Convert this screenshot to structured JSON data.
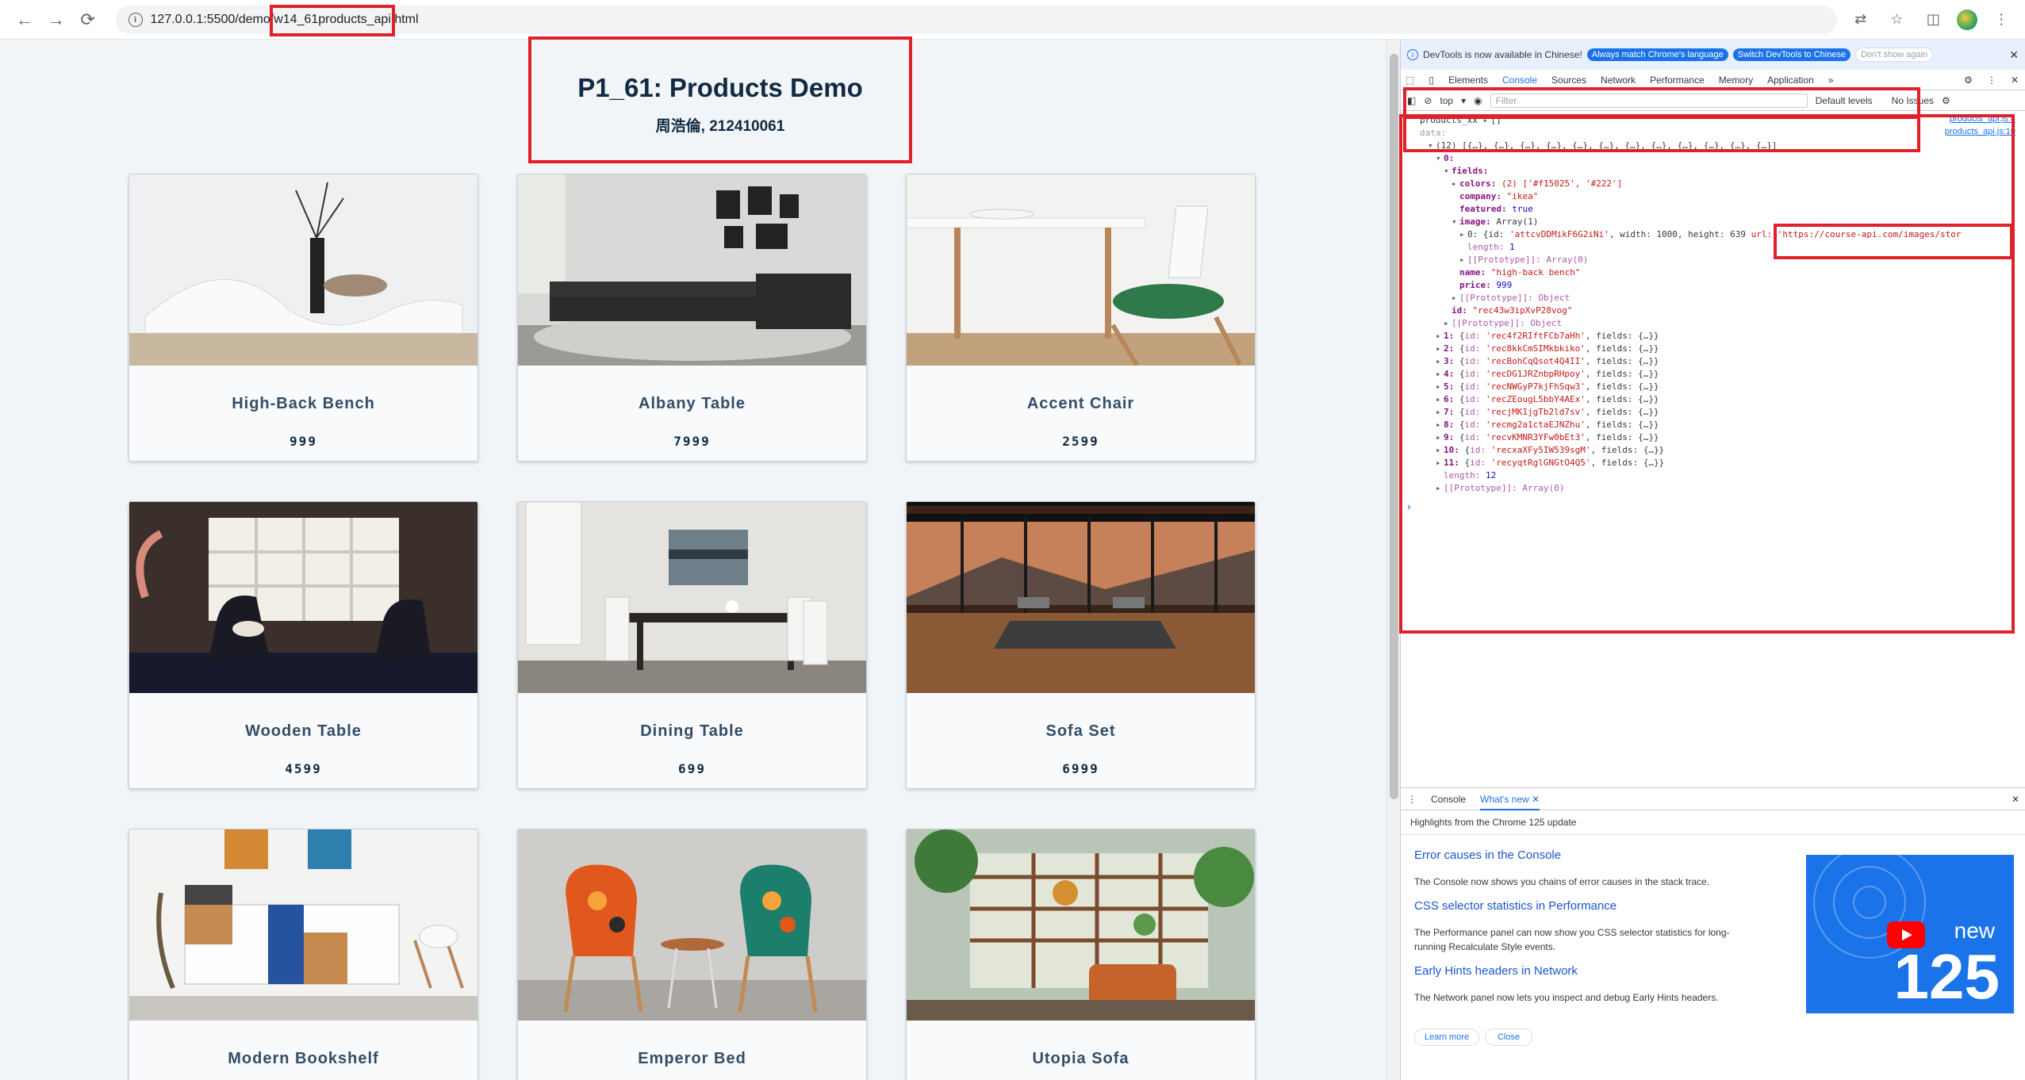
{
  "browser": {
    "url": "127.0.0.1:5500/demo/w14_61_products_api.html",
    "url_prefix": "127.0.0.1:5500/demo/w14_61",
    "url_highlight": "products_api.html"
  },
  "page": {
    "title": "P1_61: Products Demo",
    "subtitle": "周浩倫, 212410061",
    "products": [
      {
        "name": "High-Back Bench",
        "price": "999"
      },
      {
        "name": "Albany Table",
        "price": "7999"
      },
      {
        "name": "Accent Chair",
        "price": "2599"
      },
      {
        "name": "Wooden Table",
        "price": "4599"
      },
      {
        "name": "Dining Table",
        "price": "699"
      },
      {
        "name": "Sofa Set",
        "price": "6999"
      },
      {
        "name": "Modern Bookshelf",
        "price": ""
      },
      {
        "name": "Emperor Bed",
        "price": ""
      },
      {
        "name": "Utopia Sofa",
        "price": ""
      }
    ]
  },
  "devtools": {
    "infobar": {
      "text": "DevTools is now available in Chinese!",
      "btn1": "Always match Chrome's language",
      "btn2": "Switch DevTools to Chinese",
      "btn3": "Don't show again"
    },
    "tabs": [
      "Elements",
      "Console",
      "Sources",
      "Network",
      "Performance",
      "Memory",
      "Application"
    ],
    "toolbar": {
      "context": "top",
      "filter_placeholder": "Filter",
      "levels": "Default levels",
      "issues": "No Issues"
    },
    "console": {
      "line1_label": "products_xx",
      "line1_value": "[]",
      "line1_src": "products_api.js:4",
      "line2_label": "data:",
      "line2_src": "products_api.js:10",
      "array_summary": "(12) [{…}, {…}, {…}, {…}, {…}, {…}, {…}, {…}, {…}, {…}, {…}, {…}]",
      "item0": "0:",
      "fields": "fields:",
      "colors_key": "colors:",
      "colors_val": "(2) ['#f15025', '#222']",
      "company_key": "company:",
      "company_val": "\"ikea\"",
      "featured_key": "featured:",
      "featured_val": "true",
      "image_key": "image:",
      "image_val": "Array(1)",
      "image0_prefix": "0: {id: ",
      "image0_id": "'attcvDDMikF6G2iNi'",
      "image0_width": ", width: 1000, height: 639",
      "image0_url": "url: 'https://course-api.com/images/stor",
      "image_len_key": "length:",
      "image_len_val": "1",
      "proto_arr": "[[Prototype]]: Array(0)",
      "name_key": "name:",
      "name_val": "\"high-back bench\"",
      "price_key": "price:",
      "price_val": "999",
      "proto_obj": "[[Prototype]]: Object",
      "id_key": "id:",
      "id_val": "\"rec43w3ipXvP28vog\"",
      "proto_obj2": "[[Prototype]]: Object",
      "rows": [
        {
          "k": "1:",
          "id": "'rec4f2RIftFCb7aHh'"
        },
        {
          "k": "2:",
          "id": "'rec8kkCmSIMkbkiko'"
        },
        {
          "k": "3:",
          "id": "'recBohCqQsot4Q4II'"
        },
        {
          "k": "4:",
          "id": "'recDG1JRZnbpRHpoy'"
        },
        {
          "k": "5:",
          "id": "'recNWGyP7kjFhSqw3'"
        },
        {
          "k": "6:",
          "id": "'recZEougL5bbY4AEx'"
        },
        {
          "k": "7:",
          "id": "'recjMK1jgTb2ld7sv'"
        },
        {
          "k": "8:",
          "id": "'recmg2a1ctaEJNZhu'"
        },
        {
          "k": "9:",
          "id": "'recvKMNR3YFw0bEt3'"
        },
        {
          "k": "10:",
          "id": "'recxaXFy5IW539sgM'"
        },
        {
          "k": "11:",
          "id": "'recyqtRglGNGtO4Q5'"
        }
      ],
      "row_fields": ", fields: {…}}",
      "length_key": "length:",
      "length_val": "12",
      "proto_final": "[[Prototype]]: Array(0)",
      "prompt": "›"
    },
    "drawer": {
      "tabs": [
        "Console",
        "What's new"
      ],
      "highlights": "Highlights from the Chrome 125 update",
      "items": [
        {
          "title": "Error causes in the Console",
          "desc": "The Console now shows you chains of error causes in the stack trace."
        },
        {
          "title": "CSS selector statistics in Performance",
          "desc": "The Performance panel can now show you CSS selector statistics for long-running Recalculate Style events."
        },
        {
          "title": "Early Hints headers in Network",
          "desc": "The Network panel now lets you inspect and debug Early Hints headers."
        }
      ],
      "badge_new": "new",
      "badge_num": "125",
      "learn_more": "Learn more",
      "close": "Close"
    }
  }
}
